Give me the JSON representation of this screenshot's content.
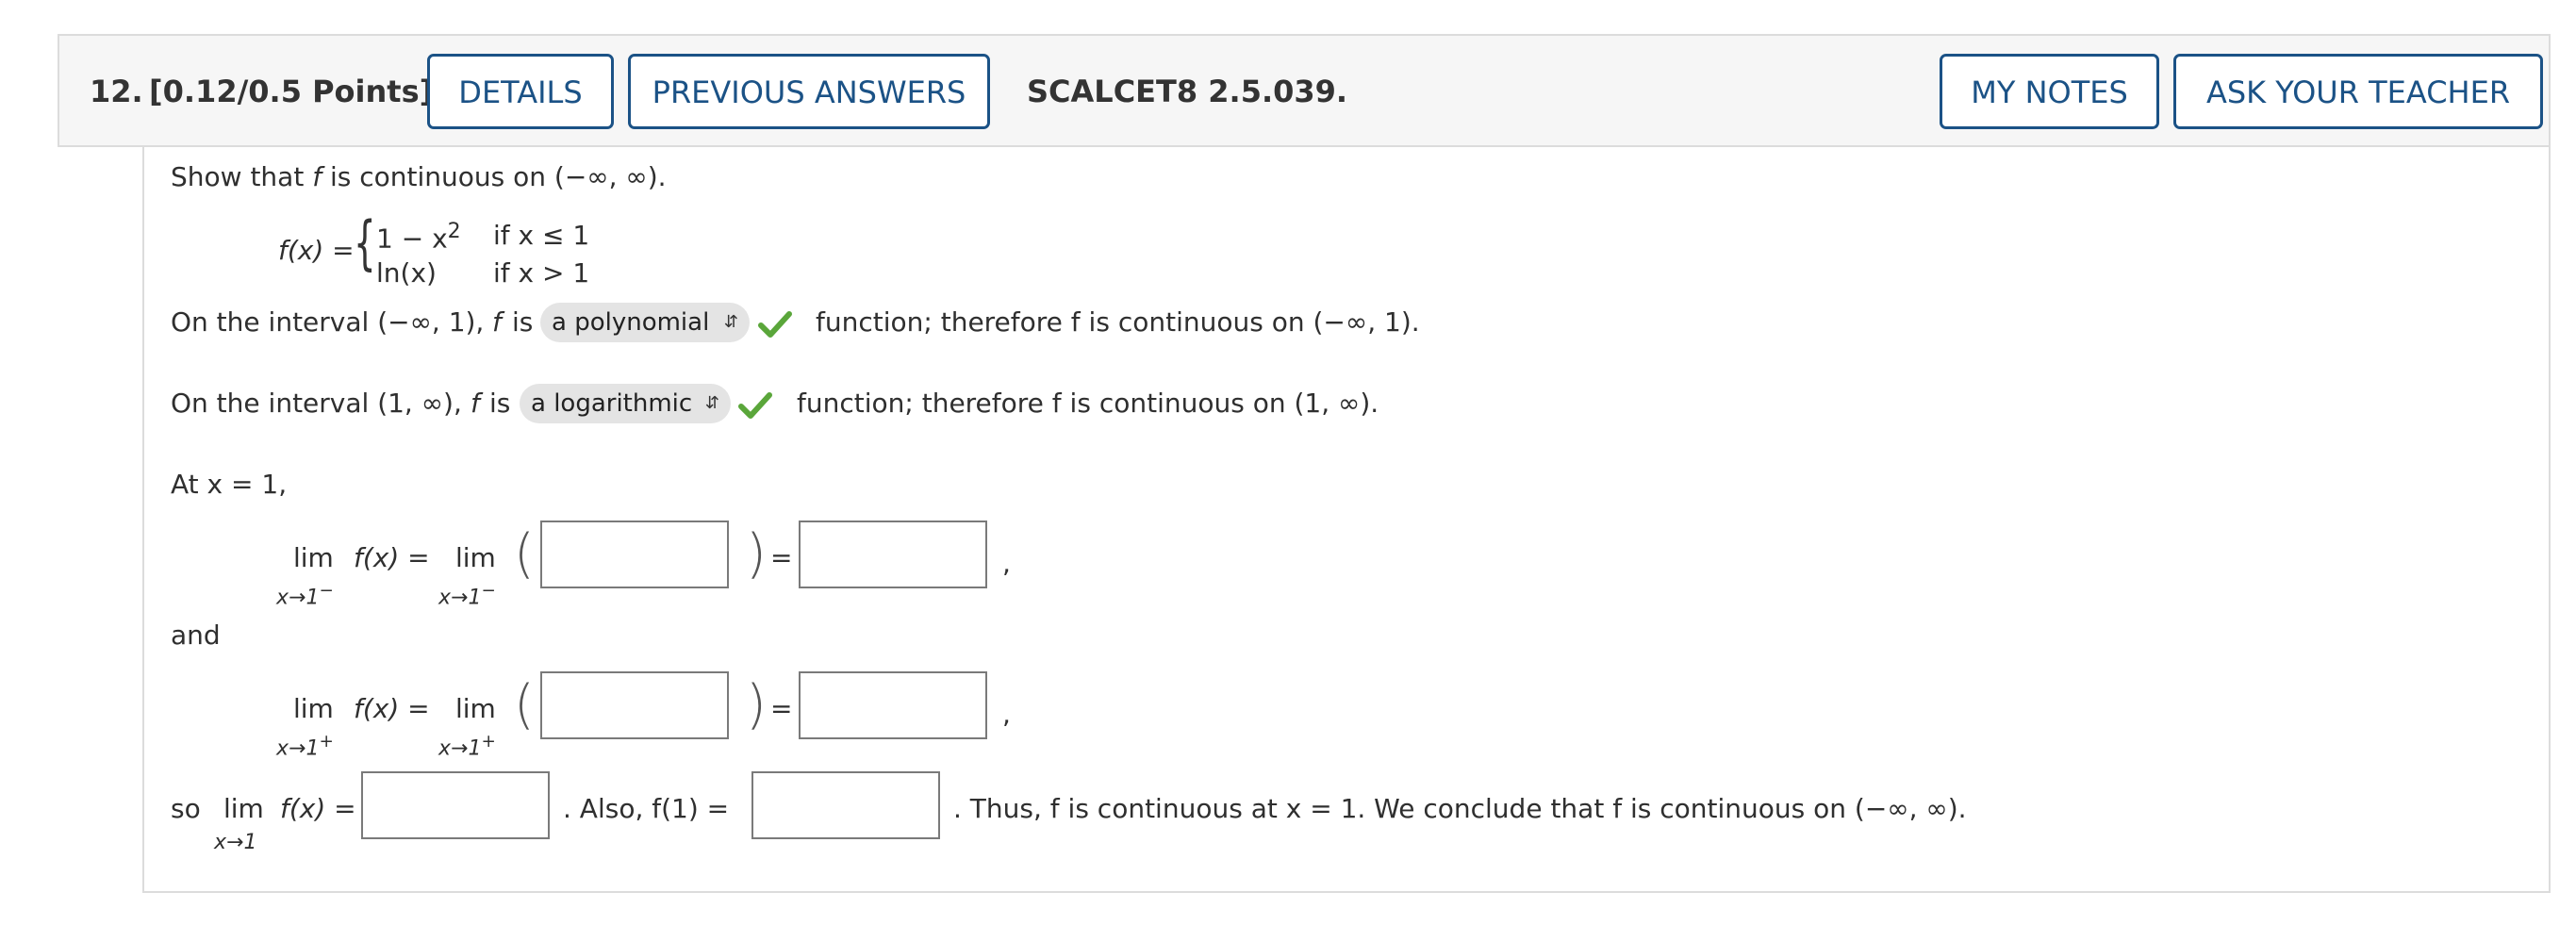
{
  "header": {
    "number": "12.",
    "points": "[0.12/0.5 Points]",
    "details_label": "DETAILS",
    "previous_answers_label": "PREVIOUS ANSWERS",
    "code": "SCALCET8 2.5.039.",
    "my_notes_label": "MY NOTES",
    "ask_teacher_label": "ASK YOUR TEACHER"
  },
  "problem": {
    "intro_pre": "Show that ",
    "intro_f": "f",
    "intro_post": " is continuous on (−∞, ∞).",
    "fx_label": "f(x) =",
    "case1_expr": "1 − x",
    "case1_exp": "2",
    "case1_cond": "if x ≤ 1",
    "case2_expr": "ln(x)",
    "case2_cond": "if x > 1"
  },
  "interval1": {
    "prefix": "On the interval  (−∞, 1),",
    "f": "f",
    "is": "is",
    "selected": "a polynomial",
    "suffix": "function; therefore f is continuous on  (−∞, 1)."
  },
  "interval2": {
    "prefix": "On the interval  (1, ∞),",
    "f": "f",
    "is": "is",
    "selected": "a logarithmic",
    "suffix": "function; therefore f is continuous on  (1, ∞)."
  },
  "at_x": "At  x = 1,",
  "limits": {
    "lim": "lim",
    "fx_eq": "f(x) =",
    "left_sub": "x→1",
    "left_sup": "−",
    "right_sub": "x→1",
    "right_sup": "+",
    "equals": "=",
    "comma": ","
  },
  "and_label": "and",
  "final": {
    "so": "so",
    "lim": "lim",
    "lim_sub": "x→1",
    "fx_eq": "f(x) =",
    "also": ".  Also,  f(1) =",
    "thus": ".  Thus, f is continuous at  x = 1.  We conclude that f is continuous on  (−∞, ∞)."
  },
  "colors": {
    "accent": "#1b5286",
    "check": "#5aa63a"
  },
  "icons": {
    "select_chevron": "updown-chevron-icon",
    "correct": "checkmark-icon"
  }
}
